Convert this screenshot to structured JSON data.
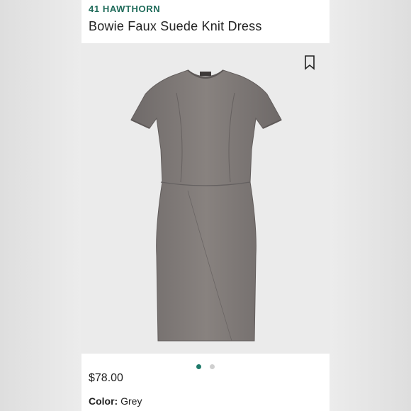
{
  "product": {
    "brand": "41 HAWTHORN",
    "title": "Bowie Faux Suede Knit Dress",
    "price": "$78.00",
    "color_label": "Color:",
    "color_value": "Grey"
  },
  "gallery": {
    "dots": [
      {
        "active": true,
        "color": "#1f7a6a"
      },
      {
        "active": false,
        "color": "#cfcfcf"
      }
    ]
  },
  "icons": {
    "bookmark": "bookmark-icon"
  },
  "colors": {
    "brand": "#1f6b5a",
    "dress": "#7d7877"
  }
}
